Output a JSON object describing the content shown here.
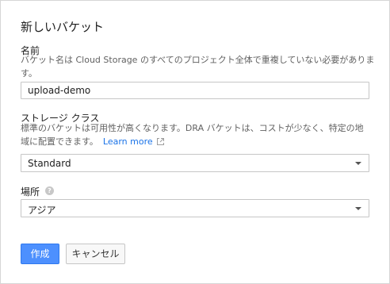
{
  "dialog": {
    "title": "新しいバケット"
  },
  "name_section": {
    "label": "名前",
    "description": "バケット名は Cloud Storage のすべてのプロジェクト全体で重複していない必要がありま",
    "description_cont": "す。",
    "value": "upload-demo"
  },
  "storage_class": {
    "label": "ストレージ クラス",
    "description_line1": "標準のバケットは可用性が高くなります。DRA バケットは、コストが少なく、特定の地",
    "description_line2": "域に配置できます。",
    "learn_more": "Learn more",
    "selected": "Standard"
  },
  "location": {
    "label": "場所",
    "help": "?",
    "selected": "アジア"
  },
  "actions": {
    "create": "作成",
    "cancel": "キャンセル"
  },
  "colors": {
    "primary_button": "#4d90fe",
    "link": "#1a73e8",
    "border": "#c6c6c6"
  },
  "icons": [
    "external-link-icon",
    "help-icon",
    "chevron-down-icon"
  ]
}
